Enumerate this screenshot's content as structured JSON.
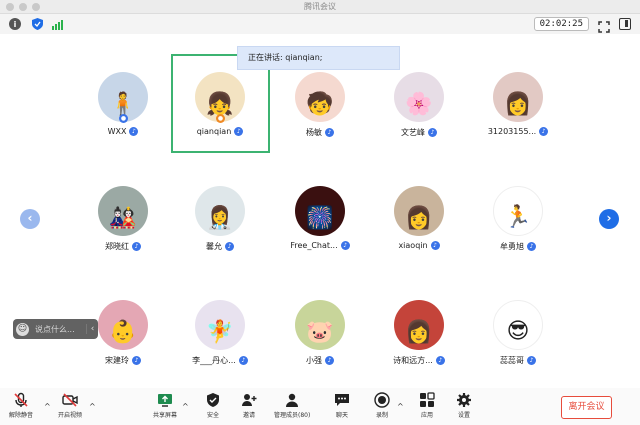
{
  "window": {
    "title": "腾讯会议"
  },
  "infobar": {
    "timer": "02:02:25"
  },
  "speaking_banner": "正在讲话: qianqian;",
  "participants": [
    {
      "name": "WXX",
      "color": "#c7d6e8",
      "glyph": "🧍",
      "host": true
    },
    {
      "name": "qianqian",
      "color": "#f3e3c2",
      "glyph": "👧",
      "host": true,
      "speaking": true
    },
    {
      "name": "杨敏",
      "color": "#f5d9d0",
      "glyph": "🧒"
    },
    {
      "name": "文艺峰",
      "color": "#e7dde6",
      "glyph": "🌸"
    },
    {
      "name": "31203155...",
      "color": "#e2c9c4",
      "glyph": "👩"
    },
    {
      "name": "郑晓红",
      "color": "#9ba9a4",
      "glyph": "🎎"
    },
    {
      "name": "馨允",
      "color": "#dfe7ea",
      "glyph": "👩‍⚕️"
    },
    {
      "name": "Free_Chat...",
      "color": "#3a1010",
      "glyph": "🎆"
    },
    {
      "name": "xiaoqin",
      "color": "#c9b49c",
      "glyph": "👩"
    },
    {
      "name": "牟勇旭",
      "color": "#ffffff",
      "glyph": "🏃"
    },
    {
      "name": "宋建玲",
      "color": "#e4a7b4",
      "glyph": "👶"
    },
    {
      "name": "李___丹心...",
      "color": "#e8e2ef",
      "glyph": "🧚"
    },
    {
      "name": "小强",
      "color": "#c8d59a",
      "glyph": "🐷"
    },
    {
      "name": "诗和远方...",
      "color": "#c4443a",
      "glyph": "👩"
    },
    {
      "name": "蕊蕊哥",
      "color": "#ffffff",
      "glyph": "😎"
    }
  ],
  "chat": {
    "placeholder": "说点什么..."
  },
  "toolbar": {
    "unmute": "解除静音",
    "video": "开启视频",
    "share": "共享屏幕",
    "security": "安全",
    "invite": "邀请",
    "members": "管理成员(80)",
    "chat": "聊天",
    "record": "录制",
    "apps": "应用",
    "settings": "设置",
    "leave": "离开会议"
  },
  "colors": {
    "accent": "#1f6de6",
    "speaking_frame": "#3cb371",
    "leave": "#e74c3c",
    "badge": "#3a73e8"
  }
}
